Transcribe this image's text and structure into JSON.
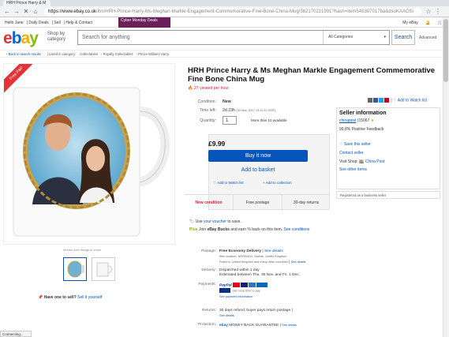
{
  "browser": {
    "tab_title": "HRH Prince Harry & M",
    "url_host": "https://www.ebay.co.uk",
    "url_path": "/itm/HRH-Prince-Harry-Ms-Meghan-Markle-Engagement-Commemorative-Fine-Bone-China-Mug/362170221991?hash=item545307017ba&dsoKAAOSi"
  },
  "topbar": {
    "greeting": "Hello Jane",
    "items": [
      "Daily Deals",
      "Sell",
      "Help & Contact"
    ],
    "promo": "Cyber Monday Deals",
    "right_items": [
      "My eBay",
      "Cart"
    ]
  },
  "header": {
    "logo": [
      "e",
      "b",
      "a",
      "y"
    ],
    "shop_by": "Shop by category",
    "search_placeholder": "Search for anything",
    "category": "All Categories",
    "search_button": "Search",
    "advanced": "Advanced"
  },
  "breadcrumb": {
    "back": "Back to search results",
    "listed_in": "Listed in category:",
    "items": [
      "Collectables",
      "Royalty Collectables",
      "Prince William/ Harry"
    ]
  },
  "gallery": {
    "ribbon": "Free P&P",
    "hint": "Mouse over image to zoom",
    "have_one": "Have one to sell?",
    "sell_link": "Sell it yourself"
  },
  "item": {
    "title": "HRH Prince Harry & Ms Meghan Markle Engagement Commemorative Fine Bone China Mug",
    "viewed": "27 viewed per hour",
    "add_watch": "Add to Watch list",
    "condition_label": "Condition:",
    "condition_value": "New",
    "time_left_label": "Time left:",
    "time_left_value": "2d 23h",
    "time_left_detail": "(30 Nov, 2017  13:11:22 GMT)",
    "quantity_label": "Quantity:",
    "quantity_value": "1",
    "available": "More than 10 available",
    "price": "£9.99",
    "buy_now": "Buy it now",
    "add_basket": "Add to basket",
    "add_watch_small": "Add to Watch list",
    "add_collection": "Add to collection",
    "badges": [
      "New condition",
      "Free postage",
      "30-day returns"
    ]
  },
  "voucher": {
    "line1_pre": "Use",
    "line1_link": "your voucher",
    "line1_post": "to save.",
    "plus_pre": "Join",
    "plus_bold": "eBay Bucks",
    "plus_post": "and earn % back on this item.",
    "plus_link": "See conditions"
  },
  "details": {
    "postage_label": "Postage:",
    "postage_value": "Free  Economy Delivery",
    "postage_link": "See details",
    "postage_located": "Item location: NORWICH, Norfolk, United Kingdom",
    "postage_to": "Posts to: United Kingdom and many other countries",
    "postage_to_link": "See details",
    "delivery_label": "Delivery:",
    "delivery_value": "Dispatched within 1 day",
    "delivery_est": "Estimated between Thu. 30 Nov. and Fri. 1 Dec.",
    "payments_label": "Payments:",
    "paypal": "PayPal",
    "paypal_credit": "Get more time to pay",
    "payment_info": "See payment information",
    "returns_label": "Returns:",
    "returns_value": "30 days refund, buyer pays return postage",
    "returns_link": "See details",
    "protection_label": "Protection:",
    "protection_value": "MONEY BACK GUARANTEE",
    "protection_link": "See details"
  },
  "seller": {
    "header": "Seller information",
    "name": "chinapost",
    "score": "(15067",
    "feedback": "99.8% Positive Feedback",
    "save": "Save this seller",
    "contact": "Contact seller",
    "visit": "Visit Shop:",
    "shop": "China Post",
    "other": "See other items",
    "footer": "Registered as a business seller"
  },
  "status_tab": "Connecting...",
  "colors": {
    "ebay_blue": "#0654ba",
    "ebay_red": "#e53238",
    "promo": "#6b1f5a"
  }
}
